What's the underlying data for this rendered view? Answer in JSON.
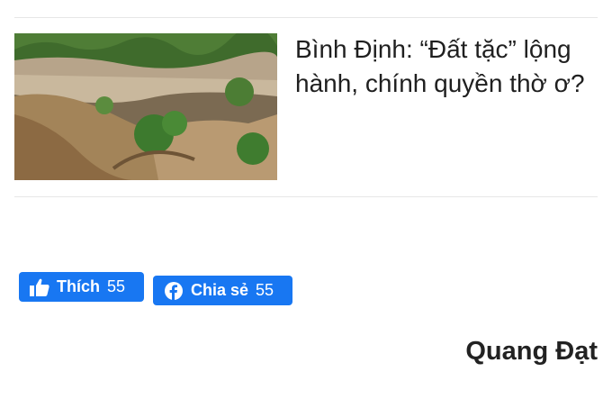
{
  "article": {
    "headline": "Bình Định: “Đất tặc” lộng hành, chính quyền thờ ơ?",
    "thumbnail_icon": "landslide-photo"
  },
  "social": {
    "like": {
      "label": "Thích",
      "count": "55",
      "icon": "thumbs-up-icon",
      "color": "#1877f2"
    },
    "share": {
      "label": "Chia sẻ",
      "count": "55",
      "icon": "facebook-icon",
      "color": "#1877f2"
    }
  },
  "byline": {
    "author": "Quang Đạt"
  }
}
